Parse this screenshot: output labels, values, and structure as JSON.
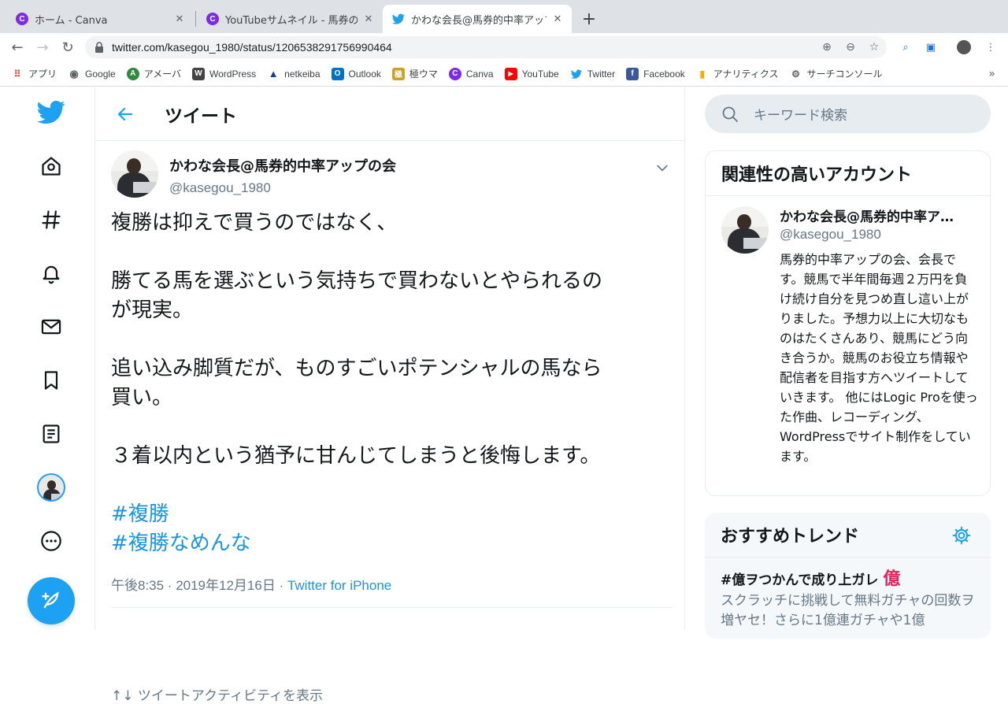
{
  "browser": {
    "tabs": [
      {
        "title": "ホーム - Canva",
        "favicon": "C"
      },
      {
        "title": "YouTubeサムネイル - 馬券の買い",
        "favicon": "C"
      },
      {
        "title": "かわな会長@馬券的中率アップの",
        "favicon": "twitter-icon"
      }
    ],
    "url": "twitter.com/kasegou_1980/status/1206538291756990464",
    "bookmarks": [
      "アプリ",
      "Google",
      "アメーバ",
      "WordPress",
      "netkeiba",
      "Outlook",
      "極ウマ",
      "Canva",
      "YouTube",
      "Twitter",
      "Facebook",
      "アナリティクス",
      "サーチコンソール"
    ]
  },
  "header": {
    "title": "ツイート"
  },
  "tweet": {
    "author_name": "かわな会長@馬券的中率アップの会",
    "handle": "@kasegou_1980",
    "lines": [
      "複勝は抑えで買うのではなく、",
      "",
      "勝てる馬を選ぶという気持ちで買わないとやられるの",
      "が現実。",
      "",
      "追い込み脚質だが、ものすごいポテンシャルの馬なら",
      "買い。",
      "",
      "３着以内という猶予に甘んじてしまうと後悔します。"
    ],
    "hashtags": [
      "#複勝",
      "#複勝なめんな"
    ],
    "timestamp": "午後8:35 · 2019年12月16日 · ",
    "source": "Twitter for iPhone",
    "cutoff_text": "↑↓ ツイートアクティビティを表示"
  },
  "search": {
    "placeholder": "キーワード検索"
  },
  "related": {
    "heading": "関連性の高いアカウント",
    "name": "かわな会長@馬券的中率ア…",
    "handle": "@kasegou_1980",
    "bio": "馬券的中率アップの会、会長です。競馬で半年間毎週２万円を負け続け自分を見つめ直し這い上がりました。予想力以上に大切なものはたくさんあり、競馬にどう向き合うか。競馬のお役立ち情報や配信者を目指す方へツイートしていきます。 他にはLogic Proを使った作曲、レコーディング、WordPressでサイト制作をしています。"
  },
  "trends": {
    "heading": "おすすめトレンド",
    "items": [
      {
        "name": "#億ヲつかんで成り上ガレ",
        "emoji": "億",
        "desc": "スクラッチに挑戦して無料ガチャの回数ヲ増ヤセ！さらに1億連ガチャや1億"
      }
    ]
  },
  "colors": {
    "twitter_blue": "#1da1f2",
    "link": "#1b95e0",
    "muted": "#657786"
  }
}
